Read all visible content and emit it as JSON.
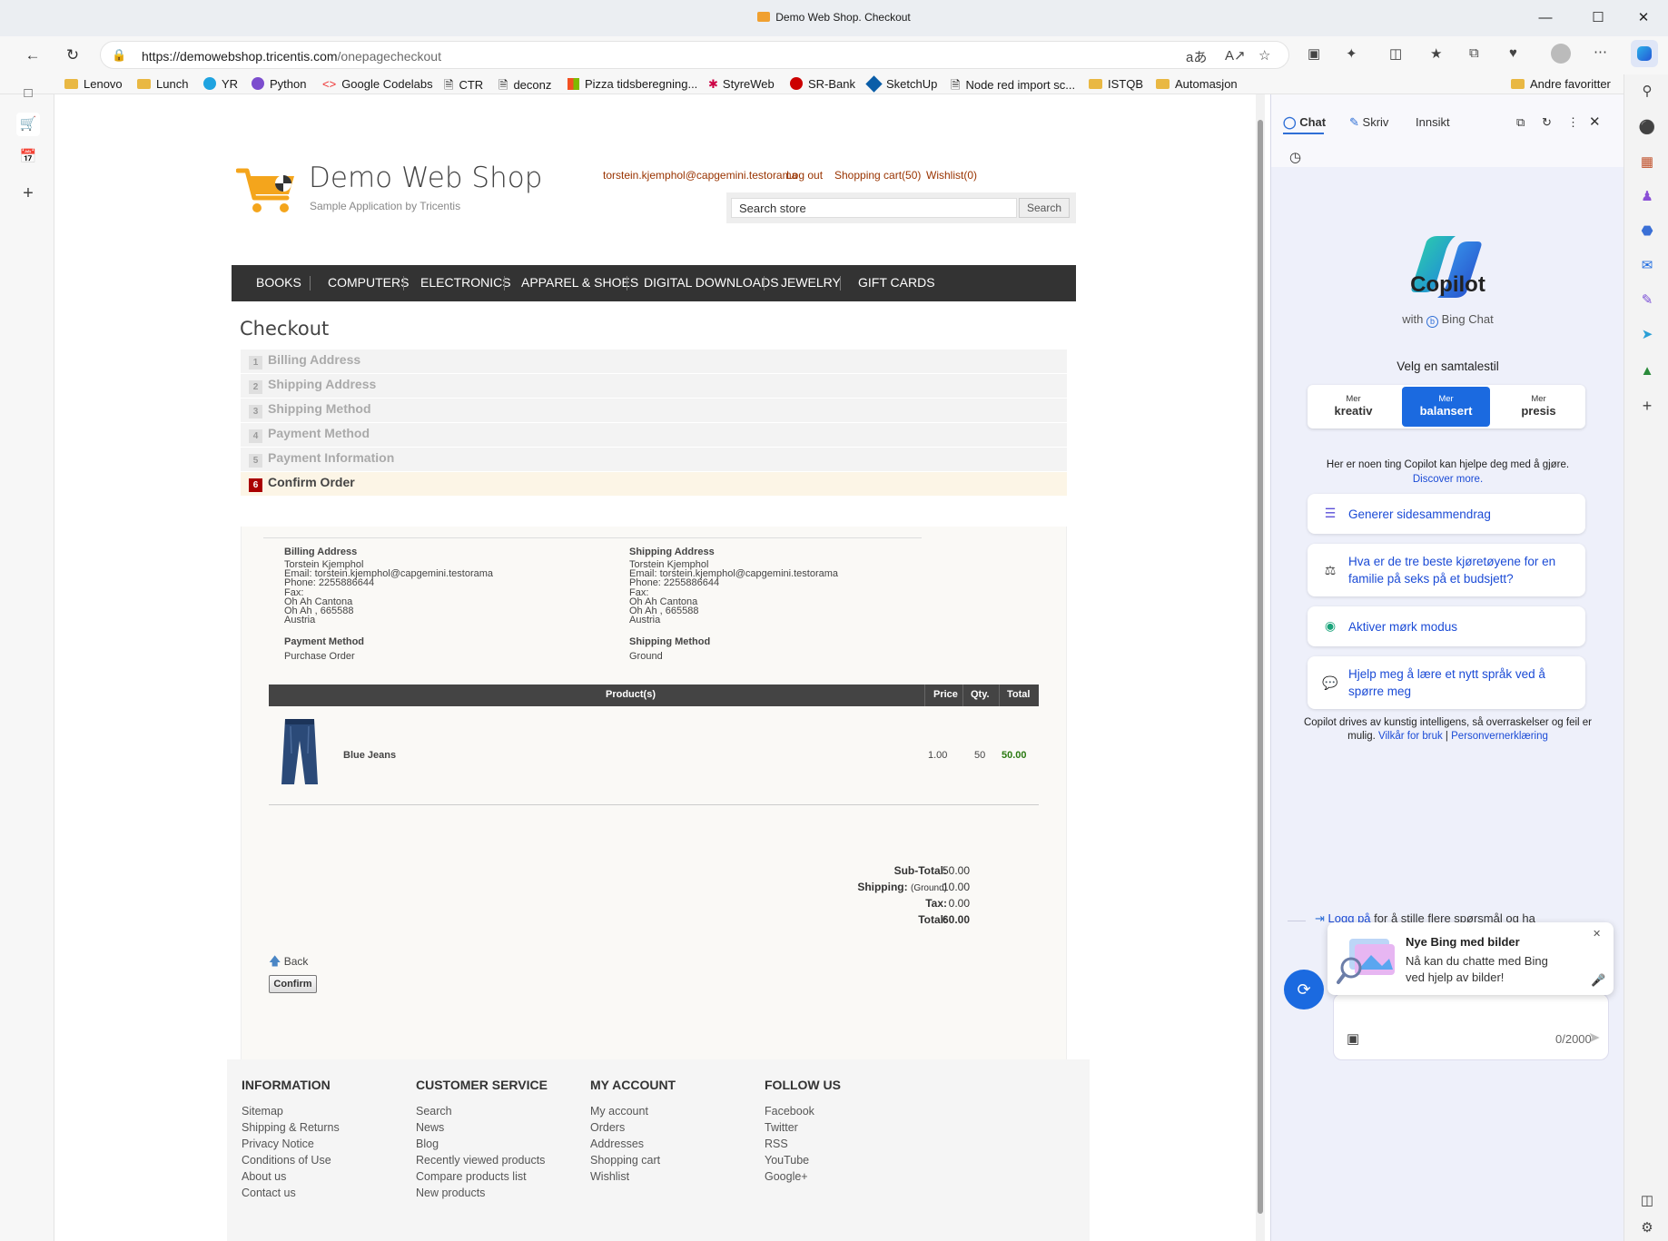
{
  "window": {
    "title": "Demo Web Shop. Checkout",
    "url_host": "https://demowebshop.tricentis.com",
    "url_path": "/onepagecheckout"
  },
  "bookmarks": [
    "Lenovo",
    "Lunch",
    "YR",
    "Python",
    "Google Codelabs",
    "CTR",
    "deconz",
    "Pizza tidsberegning...",
    "StyreWeb",
    "SR-Bank",
    "SketchUp",
    "Node red import sc...",
    "ISTQB",
    "Automasjon"
  ],
  "other_favorites": "Andre favoritter",
  "shop": {
    "name": "Demo Web Shop",
    "subtitle": "Sample Application by Tricentis",
    "header_links": {
      "account": "torstein.kjemphol@capgemini.testorama",
      "logout": "Log out",
      "cart": "Shopping cart(50)",
      "wishlist": "Wishlist(0)"
    },
    "search": {
      "value": "Search store",
      "button": "Search"
    },
    "menu": [
      "BOOKS",
      "COMPUTERS",
      "ELECTRONICS",
      "APPAREL & SHOES",
      "DIGITAL DOWNLOADS",
      "JEWELRY",
      "GIFT CARDS"
    ]
  },
  "checkout": {
    "title": "Checkout",
    "steps": [
      {
        "num": "1",
        "label": "Billing Address"
      },
      {
        "num": "2",
        "label": "Shipping Address"
      },
      {
        "num": "3",
        "label": "Shipping Method"
      },
      {
        "num": "4",
        "label": "Payment Method"
      },
      {
        "num": "5",
        "label": "Payment Information"
      },
      {
        "num": "6",
        "label": "Confirm Order"
      }
    ],
    "billing": {
      "heading": "Billing Address",
      "name": "Torstein Kjemphol",
      "email": "Email: torstein.kjemphol@capgemini.testorama",
      "phone": "Phone: 2255886644",
      "fax": "Fax:",
      "address1": "Oh Ah Cantona",
      "city": "Oh Ah , 665588",
      "country": "Austria"
    },
    "shipping": {
      "heading": "Shipping Address",
      "name": "Torstein Kjemphol",
      "email": "Email: torstein.kjemphol@capgemini.testorama",
      "phone": "Phone: 2255886644",
      "fax": "Fax:",
      "address1": "Oh Ah Cantona",
      "city": "Oh Ah , 665588",
      "country": "Austria"
    },
    "payment_method": {
      "heading": "Payment Method",
      "value": "Purchase Order"
    },
    "shipping_method": {
      "heading": "Shipping Method",
      "value": "Ground"
    },
    "table": {
      "headers": {
        "product": "Product(s)",
        "price": "Price",
        "qty": "Qty.",
        "total": "Total"
      },
      "rows": [
        {
          "name": "Blue Jeans",
          "price": "1.00",
          "qty": "50",
          "total": "50.00"
        }
      ]
    },
    "totals": {
      "subtotal_label": "Sub-Total:",
      "subtotal": "50.00",
      "shipping_label": "Shipping:",
      "shipping_note": "(Ground)",
      "shipping": "10.00",
      "tax_label": "Tax:",
      "tax": "0.00",
      "total_label": "Total:",
      "total": "60.00"
    },
    "back": "Back",
    "confirm": "Confirm"
  },
  "footer": {
    "information": {
      "title": "INFORMATION",
      "links": [
        "Sitemap",
        "Shipping & Returns",
        "Privacy Notice",
        "Conditions of Use",
        "About us",
        "Contact us"
      ]
    },
    "customer_service": {
      "title": "CUSTOMER SERVICE",
      "links": [
        "Search",
        "News",
        "Blog",
        "Recently viewed products",
        "Compare products list",
        "New products"
      ]
    },
    "my_account": {
      "title": "MY ACCOUNT",
      "links": [
        "My account",
        "Orders",
        "Addresses",
        "Shopping cart",
        "Wishlist"
      ]
    },
    "follow_us": {
      "title": "FOLLOW US",
      "links": [
        "Facebook",
        "Twitter",
        "RSS",
        "YouTube",
        "Google+"
      ]
    }
  },
  "copilot": {
    "tabs": [
      "Chat",
      "Skriv",
      "Innsikt"
    ],
    "title": "Copilot",
    "with": "with",
    "bing": "Bing Chat",
    "style_prompt": "Velg en samtalestil",
    "styles": [
      {
        "top": "Mer",
        "bottom": "kreativ"
      },
      {
        "top": "Mer",
        "bottom": "balansert"
      },
      {
        "top": "Mer",
        "bottom": "presis"
      }
    ],
    "help_text": "Her er noen ting Copilot kan hjelpe deg med å gjøre.",
    "discover": "Discover more.",
    "suggestions": [
      "Generer sidesammendrag",
      "Hva er de tre beste kjøretøyene for en familie på seks på et budsjett?",
      "Aktiver mørk modus",
      "Hjelp meg å lære et nytt språk ved å spørre meg"
    ],
    "disclaimer": "Copilot drives av kunstig intelligens, så overraskelser og feil er mulig.",
    "terms": "Vilkår for bruk",
    "privacy": "Personvernerklæring",
    "login_link": "Logg på",
    "login_text": "for å stille flere spørsmål og ha",
    "popup_title": "Nye Bing med bilder",
    "popup_text": "Nå kan du chatte med Bing ved hjelp av bilder!",
    "char_count": "0/2000"
  }
}
